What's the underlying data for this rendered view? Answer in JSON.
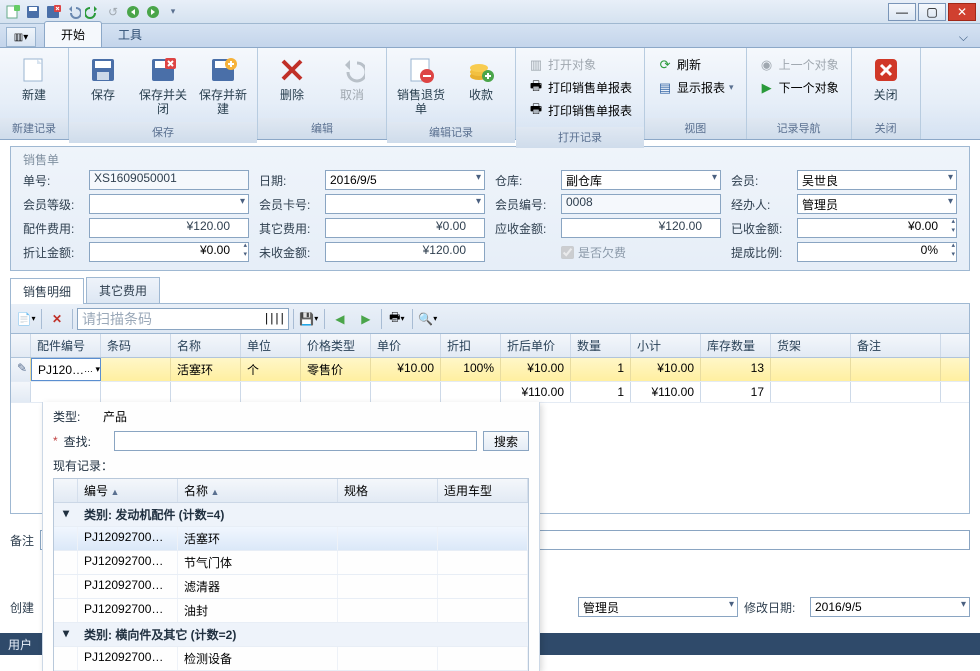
{
  "qat": {
    "items": [
      "new",
      "save",
      "save-close",
      "undo",
      "redo-green",
      "reset",
      "prev",
      "next"
    ]
  },
  "window": {
    "min": "—",
    "max": "▢",
    "close": "✕"
  },
  "ribbon": {
    "file_glyph": "▥▾",
    "tabs": [
      {
        "label": "开始",
        "active": true
      },
      {
        "label": "工具",
        "active": false
      }
    ],
    "groups": {
      "new": {
        "caption": "新建记录",
        "new": "新建"
      },
      "save": {
        "caption": "保存",
        "save": "保存",
        "save_close": "保存并关闭",
        "save_new": "保存并新建"
      },
      "edit": {
        "caption": "编辑",
        "delete": "删除",
        "cancel": "取消"
      },
      "editrec": {
        "caption": "编辑记录",
        "return": "销售退货单",
        "collect": "收款"
      },
      "openrec": {
        "caption": "打开记录",
        "open": "打开对象",
        "print1": "打印销售单报表",
        "print2": "打印销售单报表"
      },
      "view": {
        "caption": "视图",
        "refresh": "刷新",
        "showrep": "显示报表"
      },
      "nav": {
        "caption": "记录导航",
        "prev": "上一个对象",
        "next": "下一个对象"
      },
      "close": {
        "caption": "关闭",
        "close": "关闭"
      }
    }
  },
  "form": {
    "legend": "销售单",
    "labels": {
      "orderno": "单号:",
      "date": "日期:",
      "warehouse": "仓库:",
      "member": "会员:",
      "memlevel": "会员等级:",
      "memcard": "会员卡号:",
      "memid": "会员编号:",
      "operator": "经办人:",
      "partfee": "配件费用:",
      "otherfee": "其它费用:",
      "receivable": "应收金额:",
      "received": "已收金额:",
      "discount": "折让金额:",
      "unreceived": "未收金额:",
      "iscredit": "是否欠费",
      "commission": "提成比例:"
    },
    "values": {
      "orderno": "XS1609050001",
      "date": "2016/9/5",
      "warehouse": "副仓库",
      "member": "吴世良",
      "memlevel": "",
      "memcard": "",
      "memid": "0008",
      "operator": "管理员",
      "partfee": "¥120.00",
      "otherfee": "¥0.00",
      "receivable": "¥120.00",
      "received": "¥0.00",
      "discount": "¥0.00",
      "unreceived": "¥120.00",
      "iscredit_checked": true,
      "commission": "0%"
    }
  },
  "subtabs": [
    {
      "label": "销售明细",
      "active": true
    },
    {
      "label": "其它费用",
      "active": false
    }
  ],
  "gridtoolbar": {
    "scan_placeholder": "请扫描条码"
  },
  "grid": {
    "headers": {
      "partno": "配件编号",
      "barcode": "条码",
      "name": "名称",
      "unit": "单位",
      "pricetype": "价格类型",
      "price": "单价",
      "discount": "折扣",
      "discprice": "折后单价",
      "qty": "数量",
      "subtotal": "小计",
      "stock": "库存数量",
      "shelf": "货架",
      "remark": "备注"
    },
    "rows": [
      {
        "sel": true,
        "partno": "PJ120…",
        "barcode": "",
        "name": "活塞环",
        "unit": "个",
        "pricetype": "零售价",
        "price": "¥10.00",
        "discount": "100%",
        "discprice": "¥10.00",
        "qty": "1",
        "subtotal": "¥10.00",
        "stock": "13",
        "shelf": "",
        "remark": ""
      },
      {
        "sel": false,
        "partno": "",
        "barcode": "",
        "name": "",
        "unit": "",
        "pricetype": "",
        "price": "",
        "discount": "",
        "discprice": "¥110.00",
        "qty": "1",
        "subtotal": "¥110.00",
        "stock": "17",
        "shelf": "",
        "remark": ""
      }
    ]
  },
  "lookup": {
    "type_label": "类型:",
    "type_value": "产品",
    "search_label": "查找:",
    "search_btn": "搜索",
    "existing_label": "现有记录：",
    "headers": {
      "id": "编号",
      "name": "名称",
      "spec": "规格",
      "model": "适用车型"
    },
    "groups": [
      {
        "title": "类别: 发动机配件 (计数=4)",
        "rows": [
          {
            "id": "PJ12092700…",
            "name": "活塞环",
            "sel": true
          },
          {
            "id": "PJ12092700…",
            "name": "节气门体"
          },
          {
            "id": "PJ12092700…",
            "name": "滤清器"
          },
          {
            "id": "PJ12092700…",
            "name": "油封"
          }
        ]
      },
      {
        "title": "类别: 横向件及其它 (计数=2)",
        "rows": [
          {
            "id": "PJ12092700…",
            "name": "检测设备"
          }
        ]
      }
    ]
  },
  "bottom": {
    "note_label": "备注",
    "create_label": "创建",
    "creator": "管理员",
    "modify_label": "修改日期:",
    "modify_date": "2016/9/5"
  },
  "status": {
    "user_label": "用户"
  }
}
